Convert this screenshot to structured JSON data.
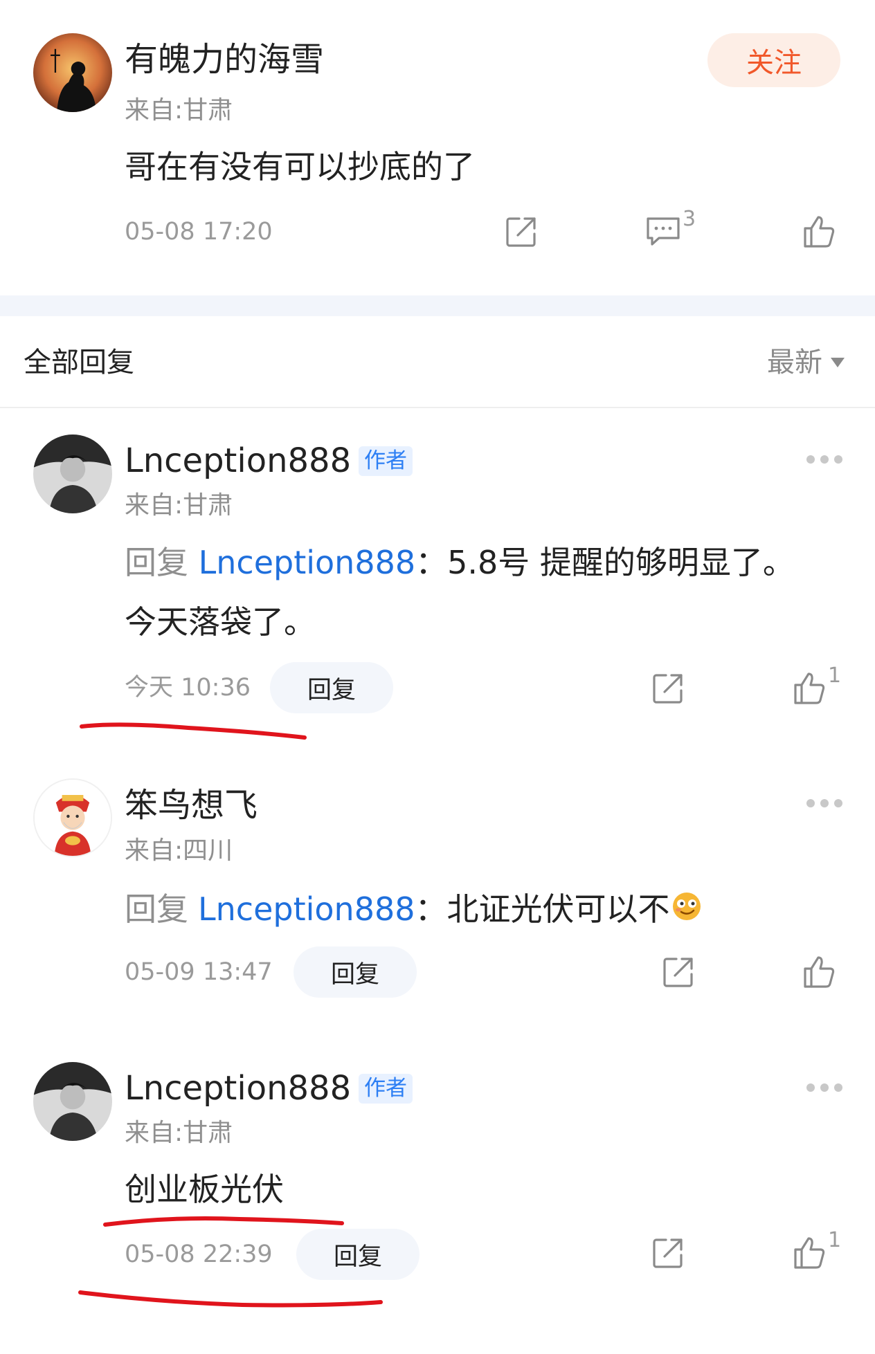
{
  "post": {
    "author": "有魄力的海雪",
    "location": "来自:甘肃",
    "follow_label": "关注",
    "content": "哥在有没有可以抄底的了",
    "time": "05-08 17:20",
    "comment_count": "3"
  },
  "replies_header": {
    "title": "全部回复",
    "sort_label": "最新"
  },
  "replies": [
    {
      "author": "Lnception888",
      "badge": "作者",
      "location": "来自:甘肃",
      "reply_prefix": "回复",
      "reply_target": "Lnception888",
      "content_line1": "：5.8号 提醒的够明显了。",
      "content_line2": "今天落袋了。",
      "time": "今天 10:36",
      "reply_label": "回复",
      "like_count": "1"
    },
    {
      "author": "笨鸟想飞",
      "location": "来自:四川",
      "reply_prefix": "回复",
      "reply_target": "Lnception888",
      "content_line1": "：北证光伏可以不",
      "time": "05-09 13:47",
      "reply_label": "回复"
    },
    {
      "author": "Lnception888",
      "badge": "作者",
      "location": "来自:甘肃",
      "content_line1": "创业板光伏",
      "time": "05-08 22:39",
      "reply_label": "回复",
      "like_count": "1"
    }
  ],
  "colors": {
    "accent_orange": "#f1582a",
    "link_blue": "#1f6fdc",
    "annotation_red": "#e0141c"
  }
}
